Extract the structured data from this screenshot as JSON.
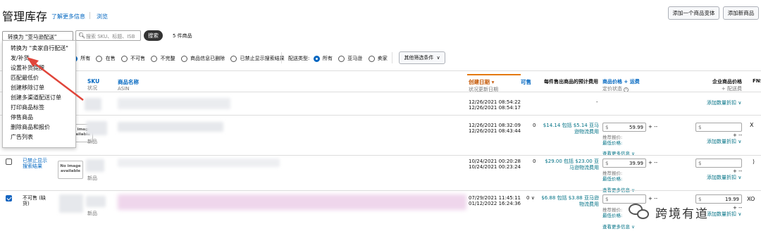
{
  "header": {
    "title": "管理库存",
    "learn_more": "了解更多信息",
    "browse": "浏览",
    "add_variation": "添加一个商品变体",
    "add_product": "添加新商品"
  },
  "toolbar": {
    "bulk_action": "转换为 \"亚马逊配送\"",
    "search_placeholder": "搜索 SKU、标题、ISB",
    "search_button": "搜索",
    "count": "5 件商品"
  },
  "filters": {
    "status_all": "所有",
    "status_active": "在售",
    "status_inactive": "不可售",
    "status_incomplete": "不完整",
    "status_suppressed": "商品信息已删除",
    "status_hidden": "已禁止显示搜索结果",
    "fulfillment_label": "配送类型:",
    "fulfillment_all": "所有",
    "fulfillment_amazon": "亚马逊",
    "fulfillment_merchant": "卖家",
    "more_filters": "其他筛选条件"
  },
  "menu": {
    "items": [
      "转换为 \"卖家自行配送\"",
      "发/补货",
      "设置补货提醒",
      "匹配最低价",
      "创建移除订单",
      "创建多渠道配送订单",
      "打印商品标签",
      "停售商品",
      "删除商品和报价",
      "广告列表"
    ]
  },
  "columns": {
    "sku": "SKU",
    "sku_sub": "状况",
    "name": "商品名称",
    "name_sub": "ASIN",
    "created": "创建日期",
    "created_sub": "状况更新日期",
    "available": "可售",
    "fee": "每件售出商品的预计费用",
    "price": "商品价格 + 运费",
    "price_sub": "定价状态",
    "biz_price": "企业商品价格",
    "biz_sub": "+ 配送费",
    "fns": "FNS"
  },
  "rows": [
    {
      "created": "12/26/2021 08:54:22",
      "updated": "12/26/2021 08:54:17",
      "available": "",
      "fee": "-",
      "price": "",
      "biz_link": "添加数量折扣"
    },
    {
      "created": "12/26/2021 08:32:09",
      "updated": "12/26/2021 08:43:44",
      "available": "0",
      "fee": "$14.14 包括 $5.14 亚马逊物流费用",
      "price": "59.99",
      "condition": "新品",
      "biz_link": "添加数量折扣"
    },
    {
      "status": "已禁止显示搜索结果",
      "created": "10/24/2021 00:20:28",
      "updated": "10/24/2021 00:23:24",
      "available": "0",
      "fee": "$29.00 包括 $23.00 亚马逊物流费用",
      "price": "39.99",
      "condition": "新品",
      "biz_link": "添加数量折扣"
    },
    {
      "status": "不可售 (缺货)",
      "created": "07/29/2021 11:45:11",
      "updated": "01/12/2022 16:24:36",
      "available": "0",
      "fee": "$6.88 包括 $3.88 亚马逊物流费用",
      "price": "",
      "biz_price": "19.99",
      "condition": "新品",
      "biz_link": "添加数量折扣"
    }
  ],
  "price_labels": {
    "suggested": "推荐报价:",
    "lowest": "最低价格:",
    "view_more": "查看更多信息",
    "currency": "$"
  },
  "no_image": "No image available",
  "watermark": "跨境有道",
  "colors": {
    "link": "#0066c0",
    "teal": "#007185",
    "orange": "#c45500",
    "arrow": "#e0453a"
  }
}
